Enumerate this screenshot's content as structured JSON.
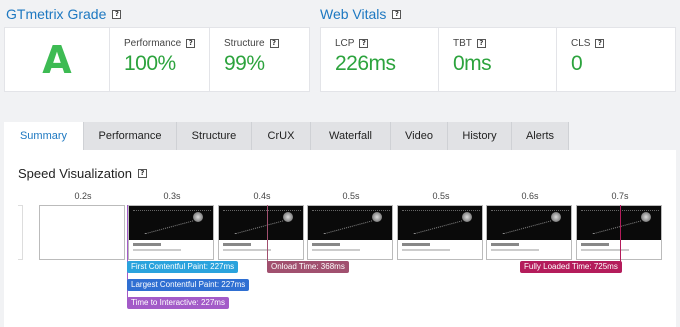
{
  "grade": {
    "title": "GTmetrix Grade",
    "letter": "A",
    "performance_label": "Performance",
    "performance_value": "100%",
    "structure_label": "Structure",
    "structure_value": "99%"
  },
  "vitals": {
    "title": "Web Vitals",
    "lcp_label": "LCP",
    "lcp_value": "226ms",
    "tbt_label": "TBT",
    "tbt_value": "0ms",
    "cls_label": "CLS",
    "cls_value": "0"
  },
  "help_glyph": "?",
  "tabs": [
    "Summary",
    "Performance",
    "Structure",
    "CrUX",
    "Waterfall",
    "Video",
    "History",
    "Alerts"
  ],
  "active_tab": "Summary",
  "speed": {
    "title": "Speed Visualization",
    "ticks": [
      "0.2s",
      "0.3s",
      "0.4s",
      "0.5s",
      "0.5s",
      "0.6s",
      "0.7s"
    ],
    "markers": {
      "fcp": "First Contentful Paint: 227ms",
      "lcp": "Largest Contentful Paint: 227ms",
      "tti": "Time to Interactive: 227ms",
      "onload": "Onload Time: 368ms",
      "fully_loaded": "Fully Loaded Time: 725ms"
    }
  },
  "colors": {
    "accent": "#1d78c1",
    "good": "#2ca33d",
    "fcp": "#2aa3dd",
    "lcp": "#2f6fd2",
    "tti": "#a35bc8",
    "onload": "#a1506f",
    "fully_loaded": "#b41c5b"
  }
}
